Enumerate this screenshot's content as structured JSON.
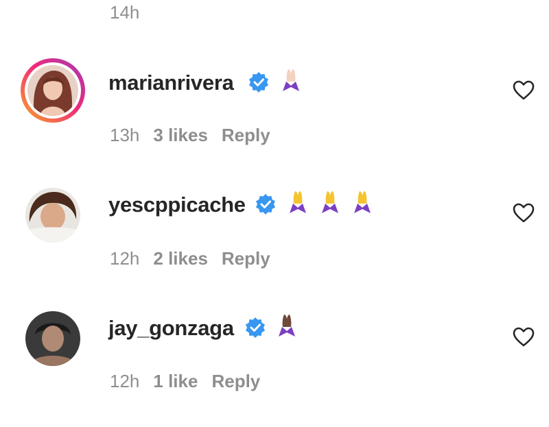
{
  "previous_comment": {
    "time": "14h"
  },
  "comments": [
    {
      "username": "marianrivera",
      "time": "13h",
      "likes": "3 likes",
      "reply": "Reply",
      "emoji": "folded-hands-light",
      "emoji_count": 1
    },
    {
      "username": "yescppicache",
      "time": "12h",
      "likes": "2 likes",
      "reply": "Reply",
      "emoji": "folded-hands-yellow",
      "emoji_count": 3
    },
    {
      "username": "jay_gonzaga",
      "time": "12h",
      "likes": "1 like",
      "reply": "Reply",
      "emoji": "folded-hands-dark",
      "emoji_count": 1
    }
  ],
  "colors": {
    "username": "#262626",
    "meta": "#8e8e8e",
    "verified": "#3897f0",
    "story_ring": [
      "#f9a825",
      "#ee2a7b",
      "#a13bb8"
    ],
    "sleeve": "#7b3fc4"
  }
}
